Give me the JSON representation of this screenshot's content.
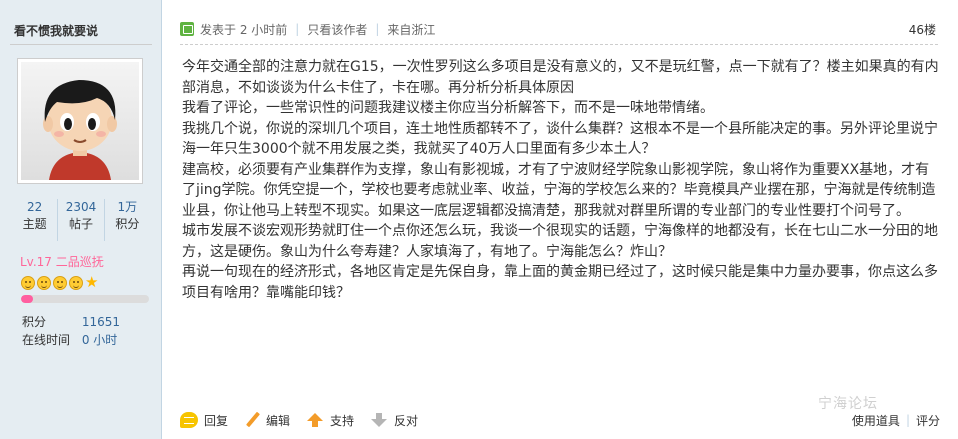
{
  "user": {
    "name": "看不惯我就要说",
    "stats": [
      {
        "value": "22",
        "label": "主题"
      },
      {
        "value": "2304",
        "label": "帖子"
      },
      {
        "value": "1万",
        "label": "积分"
      }
    ],
    "level": "Lv.17 二品巡抚",
    "level_progress_percent": 9,
    "info": [
      {
        "key": "积分",
        "value": "11651"
      },
      {
        "key": "在线时间",
        "value": "0 小时"
      }
    ]
  },
  "post": {
    "posted_label": "发表于 2 小时前",
    "author_only_link": "只看该作者",
    "location": "来自浙江",
    "floor": "46楼",
    "paragraphs": [
      "今年交通全部的注意力就在G15，一次性罗列这么多项目是没有意义的，又不是玩红警，点一下就有了？楼主如果真的有内部消息，不如谈谈为什么卡住了，卡在哪。再分析分析具体原因",
      "我看了评论，一些常识性的问题我建议楼主你应当分析解答下，而不是一味地带情绪。",
      "我挑几个说，你说的深圳几个项目，连土地性质都转不了，谈什么集群？这根本不是一个县所能决定的事。另外评论里说宁海一年只生3000个就不用发展之类，我就买了40万人口里面有多少本土人？",
      "建高校，必须要有产业集群作为支撑，象山有影视城，才有了宁波财经学院象山影视学院，象山将作为重要XX基地，才有了jing学院。你凭空提一个，学校也要考虑就业率、收益，宁海的学校怎么来的？毕竟模具产业摆在那，宁海就是传统制造业县，你让他马上转型不现实。如果这一底层逻辑都没搞清楚，那我就对群里所谓的专业部门的专业性要打个问号了。",
      "城市发展不谈宏观形势就盯住一个点你还怎么玩，我谈一个很现实的话题，宁海像样的地都没有，长在七山二水一分田的地方，这是硬伤。象山为什么夸寿建？人家填海了，有地了。宁海能怎么？炸山？",
      "再说一句现在的经济形式，各地区肯定是先保自身，靠上面的黄金期已经过了，这时候只能是集中力量办要事，你点这么多项目有啥用？靠嘴能印钱？"
    ]
  },
  "actions": {
    "reply": "回复",
    "edit": "编辑",
    "support": "支持",
    "oppose": "反对",
    "use_tool": "使用道具",
    "rate": "评分"
  },
  "watermark": "宁海论坛"
}
